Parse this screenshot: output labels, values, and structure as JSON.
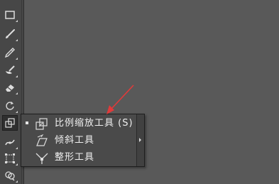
{
  "colors": {
    "canvas_bg": "#595959",
    "toolbar_bg": "#474747",
    "menu_bg": "#4a4a4a",
    "text": "#f0f0f0",
    "annotation_red": "#e03a3a"
  },
  "toolbar": {
    "tools": [
      {
        "name": "rectangle-tool",
        "icon": "rectangle-icon"
      },
      {
        "name": "paintbrush-tool",
        "icon": "paintbrush-icon"
      },
      {
        "name": "pencil-tool",
        "icon": "pencil-icon"
      },
      {
        "name": "blob-brush-tool",
        "icon": "blob-brush-icon"
      },
      {
        "name": "eraser-tool",
        "icon": "eraser-icon"
      },
      {
        "name": "rotate-tool",
        "icon": "rotate-icon"
      },
      {
        "name": "scale-tool",
        "icon": "scale-icon",
        "active": true
      },
      {
        "name": "width-tool",
        "icon": "width-icon"
      },
      {
        "name": "free-transform-tool",
        "icon": "free-transform-icon"
      },
      {
        "name": "shape-builder-tool",
        "icon": "shape-builder-icon"
      }
    ]
  },
  "flyout": {
    "items": [
      {
        "label": "比例缩放工具 (S)",
        "icon": "scale-icon",
        "selected": true
      },
      {
        "label": "倾斜工具",
        "icon": "shear-icon",
        "selected": false
      },
      {
        "label": "整形工具",
        "icon": "reshape-icon",
        "selected": false
      }
    ]
  }
}
